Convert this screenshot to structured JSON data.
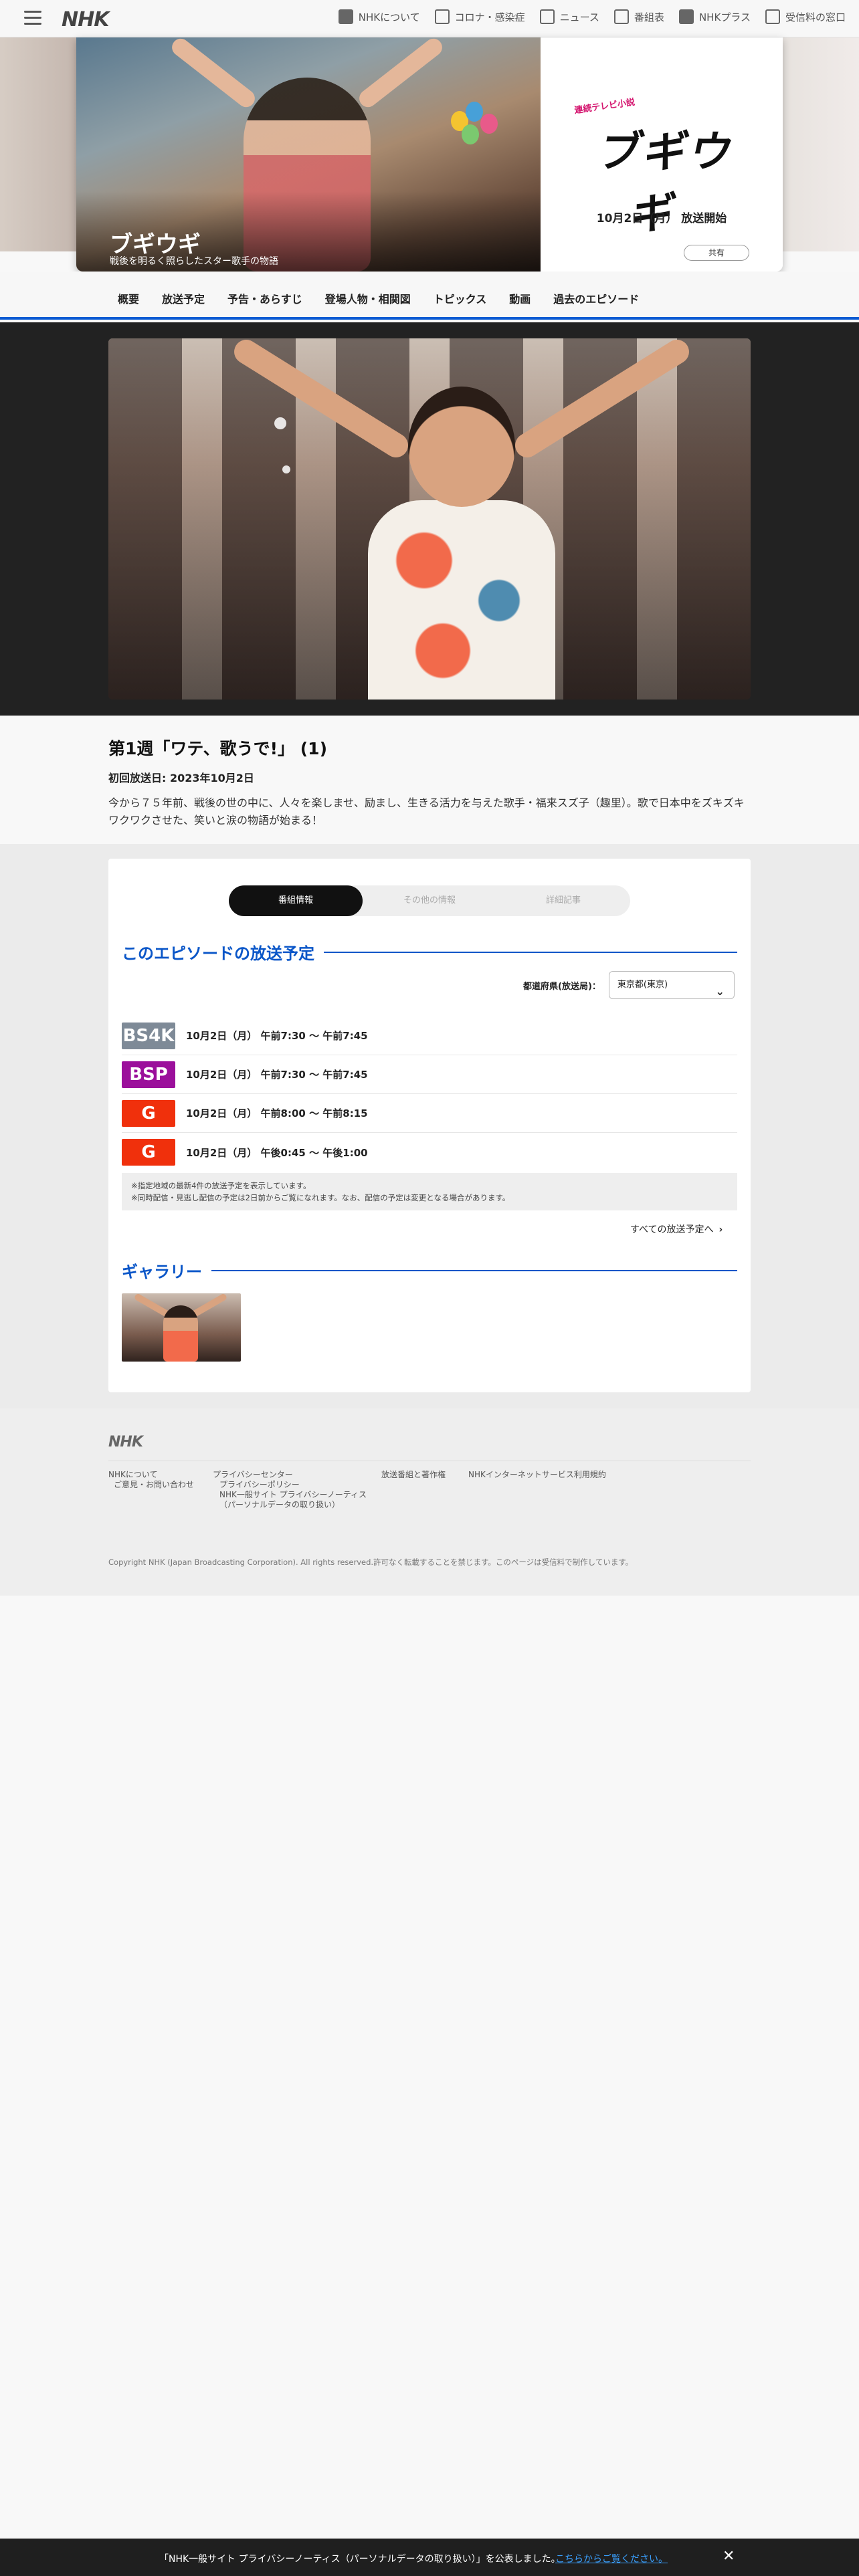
{
  "global_header": {
    "logo": "NHK",
    "links": [
      {
        "label": "NHKについて",
        "icon": "nhk-icon"
      },
      {
        "label": "コロナ・感染症",
        "icon": "corona-icon"
      },
      {
        "label": "ニュース",
        "icon": "news-icon"
      },
      {
        "label": "番組表",
        "icon": "schedule-icon"
      },
      {
        "label": "NHKプラス",
        "icon": "nhkplus-icon"
      },
      {
        "label": "受信料の窓口",
        "icon": "receiving-fee-icon"
      }
    ]
  },
  "hero": {
    "title": "ブギウギ",
    "subtitle": "戦後を明るく照らしたスター歌手の物語",
    "logo_tag": "連続テレビ小説",
    "logo_text": "ブギウギ",
    "start_date": "10月2日（月） 放送開始",
    "share_label": "共有"
  },
  "program_nav": {
    "items": [
      "概要",
      "放送予定",
      "予告・あらすじ",
      "登場人物・相関図",
      "トピックス",
      "動画",
      "過去のエピソード"
    ]
  },
  "episode": {
    "title": "第1週「ワテ、歌うで!」 (1)",
    "first_air": "初回放送日: 2023年10月2日",
    "description": "今から７５年前、戦後の世の中に、人々を楽しませ、励まし、生きる活力を与えた歌手・福来スズ子（趣里）。歌で日本中をズキズキワクワクさせた、笑いと涙の物語が始まる！"
  },
  "tabs": [
    {
      "label": "番組情報",
      "active": true
    },
    {
      "label": "その他の情報",
      "active": false
    },
    {
      "label": "詳細記事",
      "active": false
    }
  ],
  "schedule": {
    "heading": "このエピソードの放送予定",
    "region_label": "都道府県(放送局)：",
    "region_value": "東京都(東京)",
    "rows": [
      {
        "channel": "BS4K",
        "color": "#7e8a97",
        "time": "10月2日（月） 午前7:30 〜 午前7:45"
      },
      {
        "channel": "BSP",
        "color": "#9b0f9b",
        "time": "10月2日（月） 午前7:30 〜 午前7:45"
      },
      {
        "channel": "G",
        "color": "#f0300c",
        "time": "10月2日（月） 午前8:00 〜 午前8:15"
      },
      {
        "channel": "G",
        "color": "#f0300c",
        "time": "10月2日（月） 午後0:45 〜 午後1:00"
      }
    ],
    "note1": "※指定地域の最新4件の放送予定を表示しています。",
    "note2": "※同時配信・見逃し配信の予定は2日前からご覧になれます。なお、配信の予定は変更となる場合があります。",
    "all_link": "すべての放送予定へ"
  },
  "gallery": {
    "heading": "ギャラリー"
  },
  "footer": {
    "logo": "NHK",
    "col1": [
      "NHKについて",
      "ご意見・お問い合わせ"
    ],
    "col2": [
      "プライバシーセンター",
      "プライバシーポリシー",
      "NHK一般サイト プライバシーノーティス",
      "（パーソナルデータの取り扱い）"
    ],
    "col3": [
      "放送番組と著作権"
    ],
    "col4": [
      "NHKインターネットサービス利用規約"
    ],
    "copyright": "Copyright NHK (Japan Broadcasting Corporation). All rights reserved.許可なく転載することを禁じます。このページは受信料で制作しています。"
  },
  "cookie_bar": {
    "message": "「NHK一般サイト プライバシーノーティス（パーソナルデータの取り扱い）」を公表しました。",
    "link": "こちらからご覧ください。",
    "close": "✕"
  },
  "accent_color": "#0a56c8"
}
